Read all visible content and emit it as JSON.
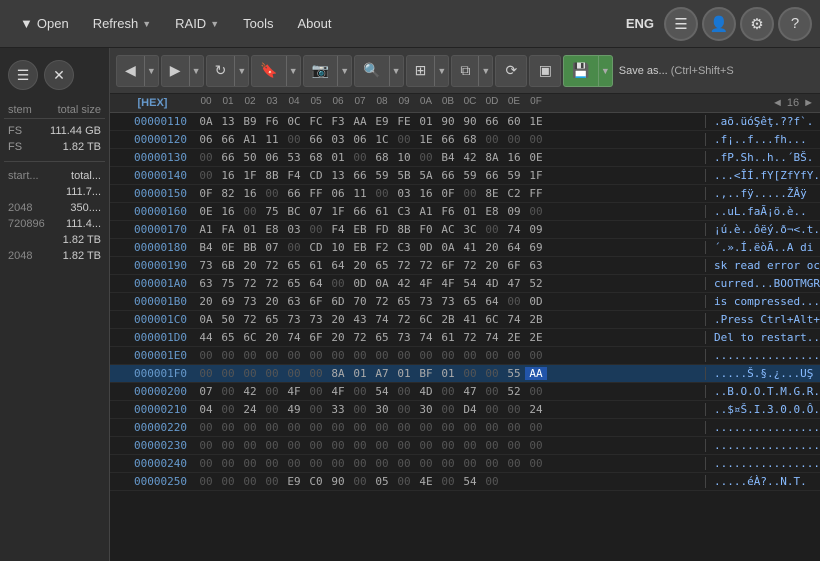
{
  "menu": {
    "items": [
      {
        "label": "Open",
        "has_arrow": true
      },
      {
        "label": "Refresh",
        "has_arrow": true
      },
      {
        "label": "RAID",
        "has_arrow": true
      },
      {
        "label": "Tools",
        "has_arrow": false
      },
      {
        "label": "About",
        "has_arrow": false
      }
    ],
    "lang": "ENG",
    "icons": [
      "≡",
      "👤",
      "⚙",
      "?"
    ]
  },
  "sidebar": {
    "icons": [
      "≡",
      "✕"
    ],
    "col1": "stem",
    "col2": "total size",
    "rows": [
      {
        "label": "FS",
        "value": "111.44 GB"
      },
      {
        "label": "FS",
        "value": "1.82 TB"
      }
    ],
    "divider": true,
    "rows2": [
      {
        "label": "start...",
        "value": "total..."
      },
      {
        "label": "",
        "value": "111.7..."
      },
      {
        "label": "2048",
        "value": "350...."
      },
      {
        "label": "720896",
        "value": "111.4..."
      },
      {
        "label": "",
        "value": "1.82 TB"
      },
      {
        "label": "2048",
        "value": "1.82 TB"
      }
    ]
  },
  "toolbar": {
    "save_label": "Save as...",
    "save_shortcut": "(Ctrl+Shift+S"
  },
  "hex_header": {
    "offset_label": "[HEX]",
    "bytes": [
      "00",
      "01",
      "02",
      "03",
      "04",
      "05",
      "06",
      "07",
      "08",
      "09",
      "0A",
      "0B",
      "0C",
      "0D",
      "0E",
      "0F"
    ],
    "nav_left": "◄",
    "nav_right": "►",
    "nav_value": "16",
    "nav_arrow": "▼"
  },
  "hex_rows": [
    {
      "offset": "00000110",
      "bytes": "0A 13 B9 F6 0C FC F3 AA E9 FE 01 90 90 66 60 1E",
      "ascii": ".aõ.üóŞêţ.??f`.",
      "selected": false
    },
    {
      "offset": "00000120",
      "bytes": "06 66 A1 11 00 66 03 06 1C 00 1E 66 68 00 00 00",
      "ascii": ".f¡..f...fh...",
      "selected": false
    },
    {
      "offset": "00000130",
      "bytes": "00 66 50 06 53 68 01 00 68 10 00 B4 42 8A 16 0E",
      "ascii": ".fP.Sh..h..´BŠ.",
      "selected": false
    },
    {
      "offset": "00000140",
      "bytes": "00 16 1F 8B F4 CD 13 66 59 5B 5A 66 59 66 59 1F",
      "ascii": "...<ÎÍ.fY[ZfYfY.",
      "selected": false
    },
    {
      "offset": "00000150",
      "bytes": "0F 82 16 00 66 FF 06 11 00 03 16 0F 00 8E C2 FF",
      "ascii": ".,..fÿ.....ŽÂÿ",
      "selected": false
    },
    {
      "offset": "00000160",
      "bytes": "0E 16 00 75 BC 07 1F 66 61 C3 A1 F6 01 E8 09 00",
      "ascii": "..uL.faÃ¡ö.è..",
      "selected": false
    },
    {
      "offset": "00000170",
      "bytes": "A1 FA 01 E8 03 00 F4 EB FD 8B F0 AC 3C 00 74 09",
      "ascii": "¡ú.è..ôëý.ð¬<.t.",
      "selected": false
    },
    {
      "offset": "00000180",
      "bytes": "B4 0E BB 07 00 CD 10 EB F2 C3 0D 0A 41 20 64 69",
      "ascii": "´.».Í.ëòÃ..A di",
      "selected": false
    },
    {
      "offset": "00000190",
      "bytes": "73 6B 20 72 65 61 64 20 65 72 72 6F 72 20 6F 63",
      "ascii": "sk read error oc",
      "selected": false
    },
    {
      "offset": "000001A0",
      "bytes": "63 75 72 72 65 64 00 0D 0A 42 4F 4F 54 4D 47 52",
      "ascii": "curred...BOOTMGR",
      "selected": false
    },
    {
      "offset": "000001B0",
      "bytes": "20 69 73 20 63 6F 6D 70 72 65 73 73 65 64 00 0D",
      "ascii": " is compressed...",
      "selected": false
    },
    {
      "offset": "000001C0",
      "bytes": "0A 50 72 65 73 73 20 43 74 72 6C 2B 41 6C 74 2B",
      "ascii": ".Press Ctrl+Alt+",
      "selected": false
    },
    {
      "offset": "000001D0",
      "bytes": "44 65 6C 20 74 6F 20 72 65 73 74 61 72 74 2E 2E",
      "ascii": "Del to restart..",
      "selected": false
    },
    {
      "offset": "000001E0",
      "bytes": "00 00 00 00 00 00 00 00 00 00 00 00 00 00 00 00",
      "ascii": "................",
      "selected": false
    },
    {
      "offset": "000001F0",
      "bytes": "00 00 00 00 00 00 8A 01 A7 01 BF 01 00 00 55 AA",
      "ascii": ".....Š.§.¿...UŞ",
      "selected": true
    },
    {
      "offset": "00000200",
      "bytes": "07 00 42 00 4F 00 4F 00 54 00 4D 00 47 00 52 00",
      "ascii": "..B.O.O.T.M.G.R.",
      "selected": false
    },
    {
      "offset": "00000210",
      "bytes": "04 00 24 00 49 00 33 00 30 00 30 00 D4 00 00 24",
      "ascii": "..$¤Š.I.3.0.0.Ô..$",
      "selected": false
    },
    {
      "offset": "00000220",
      "bytes": "00 00 00 00 00 00 00 00 00 00 00 00 00 00 00 00",
      "ascii": "................",
      "selected": false
    },
    {
      "offset": "00000230",
      "bytes": "00 00 00 00 00 00 00 00 00 00 00 00 00 00 00 00",
      "ascii": "................",
      "selected": false
    },
    {
      "offset": "00000240",
      "bytes": "00 00 00 00 00 00 00 00 00 00 00 00 00 00 00 00",
      "ascii": "................",
      "selected": false
    },
    {
      "offset": "00000250",
      "bytes": "00 00 00 00 E9 C0 90 00 05 00 4E 00 54 00",
      "ascii": ".....éÀ?..N.T.",
      "selected": false
    }
  ]
}
